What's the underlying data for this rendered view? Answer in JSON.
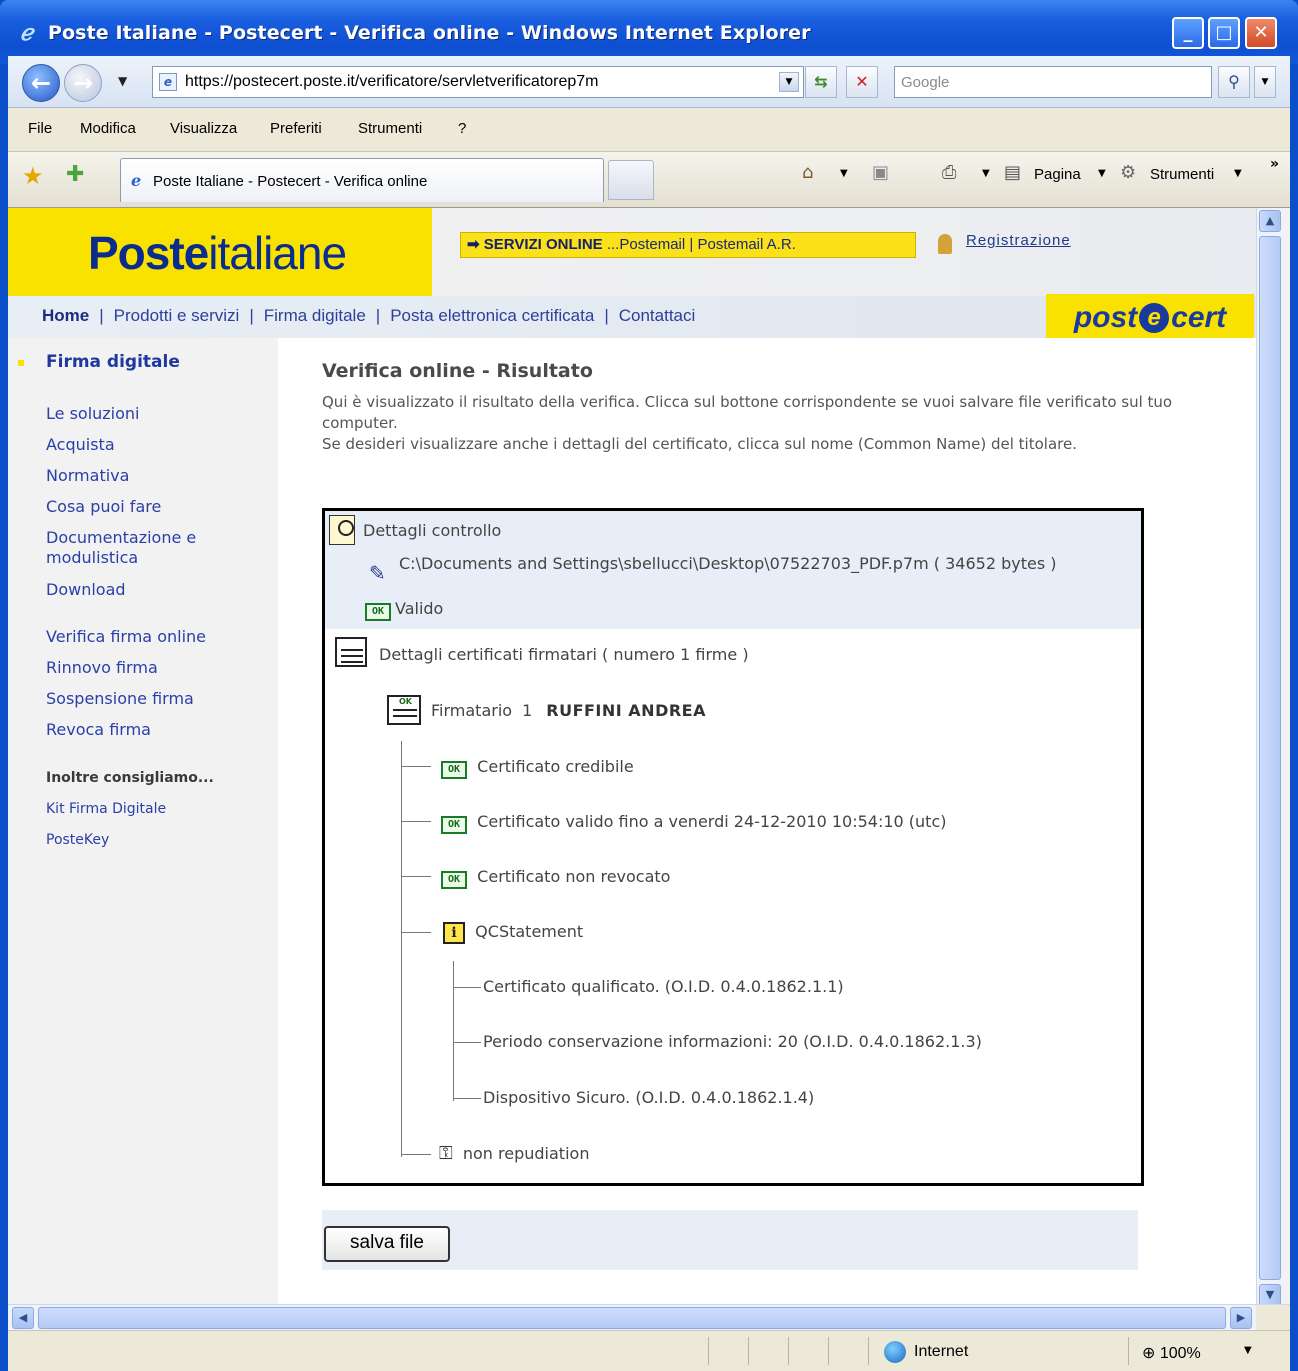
{
  "window": {
    "title": "Poste Italiane - Postecert - Verifica online - Windows Internet Explorer",
    "logo_glyph": "ℯ"
  },
  "toolbar": {
    "url": "https://postecert.poste.it/verificatore/servletverificatorep7m",
    "search_placeholder": "Google"
  },
  "menu": {
    "items": [
      "File",
      "Modifica",
      "Visualizza",
      "Preferiti",
      "Strumenti",
      "?"
    ]
  },
  "tabs": {
    "active_label": "Poste Italiane - Postecert - Verifica online"
  },
  "commandbar": {
    "page_label": "Pagina",
    "tools_label": "Strumenti"
  },
  "header": {
    "logo_bold": "Poste",
    "logo_light": "italiane",
    "servizi_title": "SERVIZI ONLINE",
    "servizi_links": [
      "...Postemail",
      "Postemail A.R."
    ],
    "registrazione": "Registrazione",
    "postecert_left": "post",
    "postecert_e": "e",
    "postecert_right": "cert"
  },
  "nav": {
    "items": [
      "Home",
      "Prodotti e servizi",
      "Firma digitale",
      "Posta elettronica certificata",
      "Contattaci"
    ]
  },
  "sidebar": {
    "title": "Firma digitale",
    "group1": [
      "Le soluzioni",
      "Acquista",
      "Normativa",
      "Cosa puoi fare",
      "Documentazione e modulistica",
      "Download"
    ],
    "group2": [
      "Verifica firma online",
      "Rinnovo firma",
      "Sospensione firma",
      "Revoca firma"
    ],
    "also_heading": "Inoltre consigliamo...",
    "also_links": [
      "Kit Firma Digitale",
      "PosteKey"
    ]
  },
  "main": {
    "title": "Verifica online - Risultato",
    "intro_1": "Qui è visualizzato il risultato della verifica. Clicca sul bottone corrispondente se vuoi salvare file verificato sul tuo computer.",
    "intro_2": "Se desideri visualizzare anche i dettagli del certificato, clicca sul nome (Common Name) del titolare."
  },
  "result": {
    "controllo_title": "Dettagli controllo",
    "file_path": "C:\\Documents and Settings\\sbellucci\\Desktop\\07522703_PDF.p7m  ( 34652 bytes )",
    "ok_badge": "OK",
    "valid_label": "Valido",
    "certificati_title": "Dettagli certificati firmatari ( numero 1 firme )",
    "signer_label": "Firmatario",
    "signer_number": "1",
    "signer_name": "RUFFINI ANDREA",
    "checks": [
      "Certificato credibile",
      "Certificato valido fino a venerdi 24-12-2010 10:54:10 (utc)",
      "Certificato non revocato"
    ],
    "qc_label": "QCStatement",
    "qc_items": [
      "Certificato qualificato. (O.I.D. 0.4.0.1862.1.1)",
      "Periodo conservazione informazioni: 20 (O.I.D. 0.4.0.1862.1.3)",
      "Dispositivo Sicuro. (O.I.D. 0.4.0.1862.1.4)"
    ],
    "nonrep_label": "non repudiation"
  },
  "actions": {
    "save_label": "salva file"
  },
  "status": {
    "zone": "Internet",
    "zoom": "100%"
  }
}
